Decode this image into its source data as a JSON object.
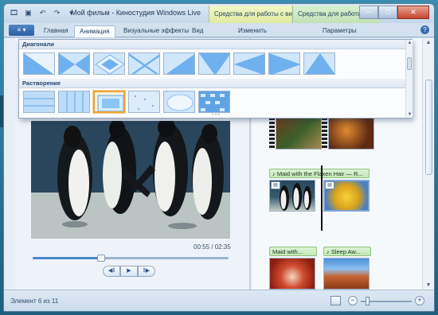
{
  "window": {
    "title": "Мой фильм - Киностудия Windows Live",
    "contextual_tabs": {
      "video_tools": "Средства для работы с видео",
      "music_tools": "Средства для работы с муз..."
    },
    "buttons": {
      "minimize": "─",
      "maximize": "□",
      "close": "✕"
    }
  },
  "ribbon": {
    "file_button": "≡ ▾",
    "tabs": [
      {
        "label": "Главная"
      },
      {
        "label": "Анимация",
        "active": true
      },
      {
        "label": "Визуальные эффекты"
      },
      {
        "label": "Вид"
      },
      {
        "label": "Изменить"
      },
      {
        "label": "Параметры"
      }
    ],
    "help": "?"
  },
  "gallery": {
    "sections": [
      {
        "title": "Диагонали",
        "tile_count": 9
      },
      {
        "title": "Растворение",
        "tile_count": 6,
        "selected_index": 2
      }
    ],
    "grip": "• • •"
  },
  "player": {
    "time": "00:55 / 02:35",
    "progress_fraction": 0.35,
    "controls": {
      "prev": "◀‖",
      "play": "▶",
      "next": "‖▶"
    }
  },
  "storyboard": {
    "music_captions": [
      "♪ Maid with the Flaxen Hair — R...",
      "Maid with...",
      "♪ Sleep Aw..."
    ]
  },
  "status": {
    "element_text": "Элемент 6 из 11",
    "zoom_minus": "−",
    "zoom_plus": "+"
  },
  "colors": {
    "selected_tile_border": "#e7a33e",
    "video_tools_tab": "#dfeaa0",
    "music_tools_tab": "#bfe3b5",
    "music_caption": "#c2e7b6"
  }
}
